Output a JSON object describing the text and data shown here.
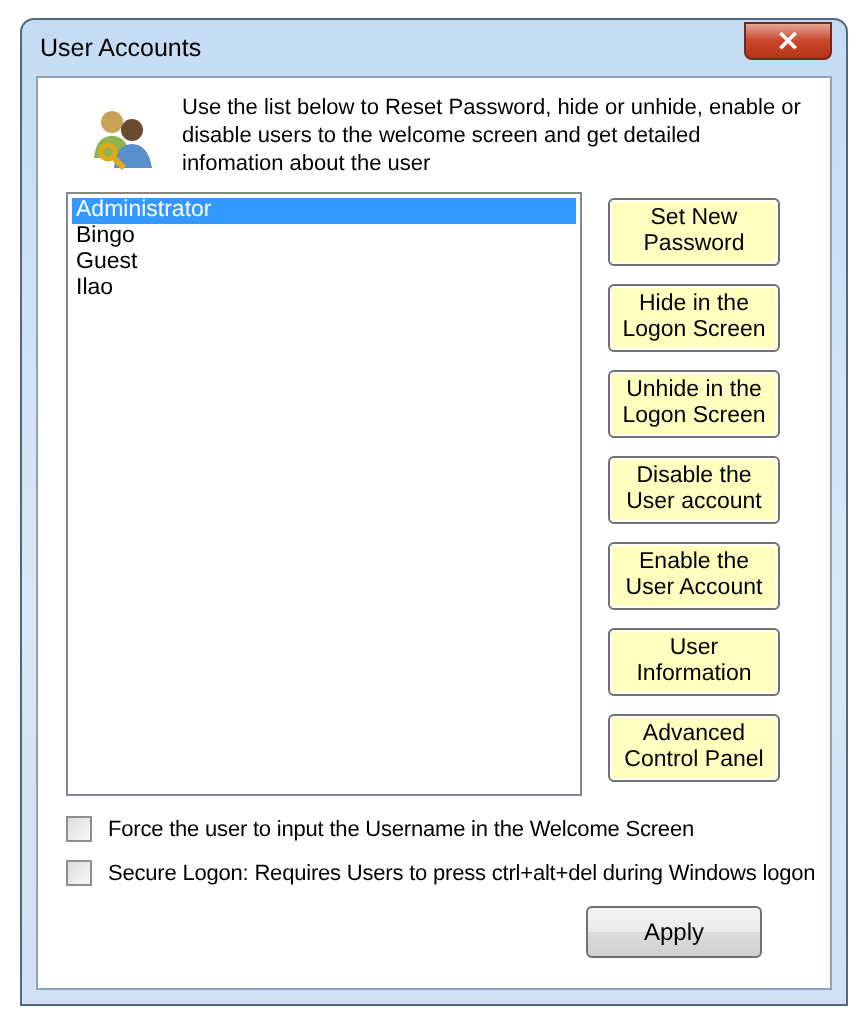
{
  "window": {
    "title": "User Accounts",
    "close": "×"
  },
  "description": "Use the list below to Reset Password, hide or unhide, enable or disable users to the welcome screen and get detailed infomation about the user",
  "users": [
    {
      "name": "Administrator",
      "selected": true
    },
    {
      "name": "Bingo",
      "selected": false
    },
    {
      "name": "Guest",
      "selected": false
    },
    {
      "name": "Ilao",
      "selected": false
    }
  ],
  "actions": [
    "Set New Password",
    "Hide in the Logon Screen",
    "Unhide in the Logon Screen",
    "Disable the User account",
    "Enable the User Account",
    "User Information",
    "Advanced Control Panel"
  ],
  "options": [
    {
      "label": "Force the user to input the Username in the Welcome Screen",
      "checked": false
    },
    {
      "label": "Secure Logon: Requires Users to press ctrl+alt+del during Windows logon",
      "checked": false
    }
  ],
  "apply": "Apply"
}
